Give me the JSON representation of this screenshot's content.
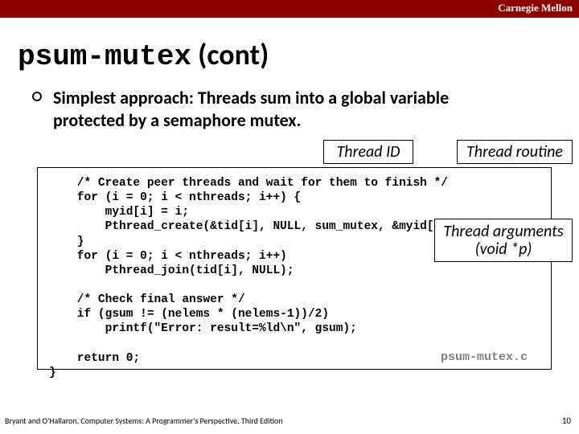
{
  "brand": "Carnegie Mellon",
  "title": {
    "code": "psum-mutex",
    "rest": " (cont)"
  },
  "bullet": "Simplest approach: Threads sum into a global variable protected by a semaphore mutex.",
  "labels": {
    "thread_id": "Thread ID",
    "thread_routine": "Thread routine",
    "thread_args_l1": "Thread arguments",
    "thread_args_l2": "(void *p)"
  },
  "code": "    /* Create peer threads and wait for them to finish */\n    for (i = 0; i < nthreads; i++) {\n        myid[i] = i;\n        Pthread_create(&tid[i], NULL, sum_mutex, &myid[i]);\n    }\n    for (i = 0; i < nthreads; i++)\n        Pthread_join(tid[i], NULL);\n\n    /* Check final answer */\n    if (gsum != (nelems * (nelems-1))/2)\n        printf(\"Error: result=%ld\\n\", gsum);\n\n    return 0;\n}",
  "source_file": "psum-mutex.c",
  "footer": "Bryant and O'Hallaron, Computer Systems: A Programmer's Perspective, Third Edition",
  "page_number": "10"
}
